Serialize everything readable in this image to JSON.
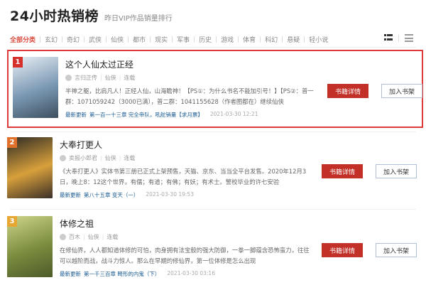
{
  "header": {
    "title": "24小时热销榜",
    "subtitle": "昨日VIP作品销量排行"
  },
  "categories": [
    "全部分类",
    "玄幻",
    "奇幻",
    "武侠",
    "仙侠",
    "都市",
    "现实",
    "军事",
    "历史",
    "游戏",
    "体育",
    "科幻",
    "悬疑",
    "轻小说"
  ],
  "active_category": "全部分类",
  "view_icons": [
    "grid-view-icon",
    "list-view-icon"
  ],
  "books": [
    {
      "rank": "1",
      "rank_color": "#d5302a",
      "title": "这个人仙太过正经",
      "author": "言归正传",
      "genre": "仙侠",
      "status": "连载",
      "desc": "半神之躯，比肩凡人！正经人仙，山海瞻神！【PS①：为什么书名不能加引号！】【PS②：普一群：1071059242（3000已满），普二群：1041155628（作者图都在）继续仙侠",
      "update_label": "最新更新",
      "chapter": "第一百一十三章 完全帝队，吼舵销量【求月票】",
      "time": "2021-03-30 12:21",
      "detail_label": "书籍详情",
      "shelf_label": "加入书架",
      "cover_colors": [
        "#e8eef4",
        "#7a98b3",
        "#3d4f5e"
      ]
    },
    {
      "rank": "2",
      "rank_color": "#e0702b",
      "title": "大奉打更人",
      "author": "卖报小郎君",
      "genre": "仙侠",
      "status": "连载",
      "desc": "《大奉打更人》实体书第三册已正式上架预售，天猫、京东、当当全平台发售。2020年12月3日，晚上8：12这个世界，有儒；有道；有佛；有妖；有术士。警校毕业的许七安验",
      "update_label": "最新更新",
      "chapter": "第八十五章 变天（一）",
      "time": "2021-03-30 19:53",
      "detail_label": "书籍详情",
      "shelf_label": "加入书架",
      "cover_colors": [
        "#2d2a24",
        "#d8a03b",
        "#3a2f28"
      ]
    },
    {
      "rank": "3",
      "rank_color": "#e8a633",
      "title": "体修之祖",
      "author": "百木",
      "genre": "仙侠",
      "status": "连载",
      "desc": "在修仙界，人人都知道体修的可怕，肉身拥有法宝般的强大防御，一拳一脚蕴含恐怖蛮力，往往可以越阶而战，战斗力惊人。那么在早期的修仙界，第一位体修是怎么出现",
      "update_label": "最新更新",
      "chapter": "第一千三百章 畸形的内鬼（下）",
      "time": "2021-03-30 03:16",
      "detail_label": "书籍详情",
      "shelf_label": "加入书架",
      "cover_colors": [
        "#cfd58a",
        "#7a8c3e",
        "#4d5a2a"
      ]
    }
  ]
}
